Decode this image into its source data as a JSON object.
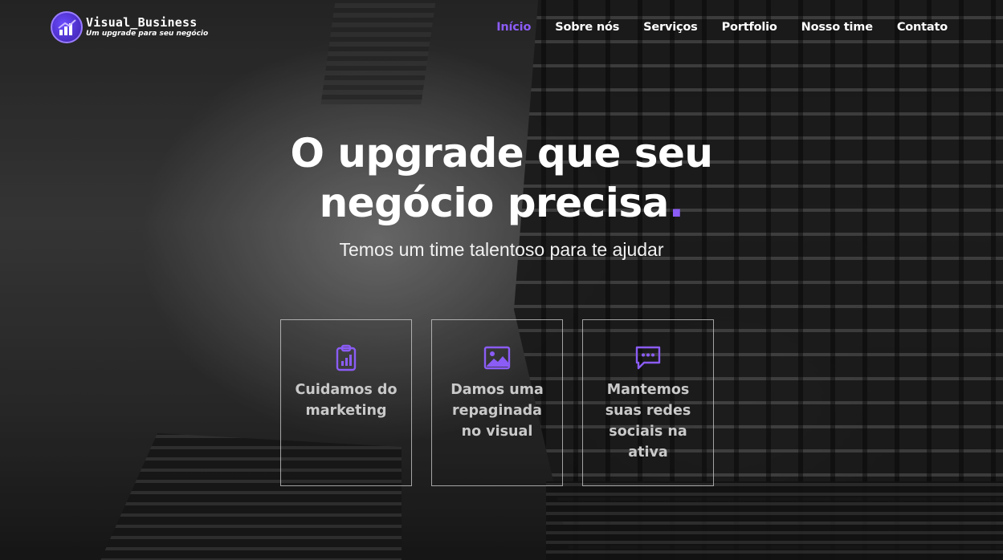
{
  "brand": {
    "name": "Visual_Business",
    "tagline": "Um upgrade para seu negócio",
    "accent_color": "#8b5cf6"
  },
  "nav": {
    "items": [
      {
        "label": "Início",
        "active": true
      },
      {
        "label": "Sobre nós",
        "active": false
      },
      {
        "label": "Serviços",
        "active": false
      },
      {
        "label": "Portfolio",
        "active": false
      },
      {
        "label": "Nosso time",
        "active": false
      },
      {
        "label": "Contato",
        "active": false
      }
    ]
  },
  "hero": {
    "headline_line1": "O upgrade que seu",
    "headline_line2": "negócio precisa",
    "headline_dot": ".",
    "subtitle": "Temos um time talentoso para te ajudar"
  },
  "cards": [
    {
      "icon": "clipboard-chart-icon",
      "text": "Cuidamos do marketing"
    },
    {
      "icon": "image-icon",
      "text": "Damos uma repaginada no visual"
    },
    {
      "icon": "chat-bubble-icon",
      "text": "Mantemos suas redes sociais na ativa"
    }
  ]
}
